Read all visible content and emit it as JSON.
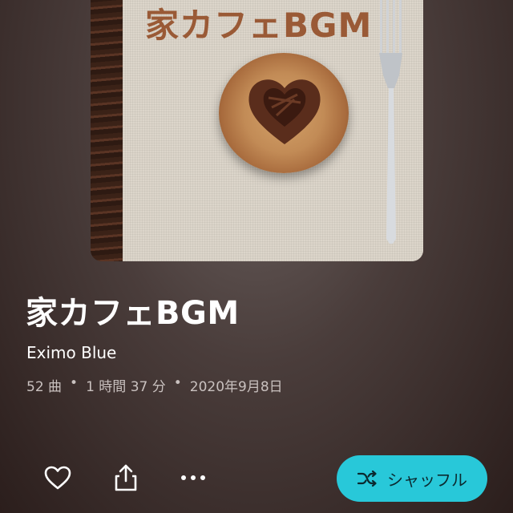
{
  "album": {
    "cover_text": "家カフェBGM",
    "title": "家カフェBGM",
    "artist": "Eximo Blue",
    "meta": {
      "tracks": "52 曲",
      "separator": "•",
      "duration": "1 時間 37 分",
      "release_date": "2020年9月8日"
    }
  },
  "actions": {
    "favorite_icon": "heart-outline-icon",
    "share_icon": "share-icon",
    "more_icon": "more-horizontal-icon",
    "shuffle_icon": "shuffle-icon",
    "shuffle_label": "シャッフル"
  },
  "colors": {
    "accent": "#28c8d9",
    "title_text": "#ffffff",
    "meta_text": "#c9c1bf"
  }
}
